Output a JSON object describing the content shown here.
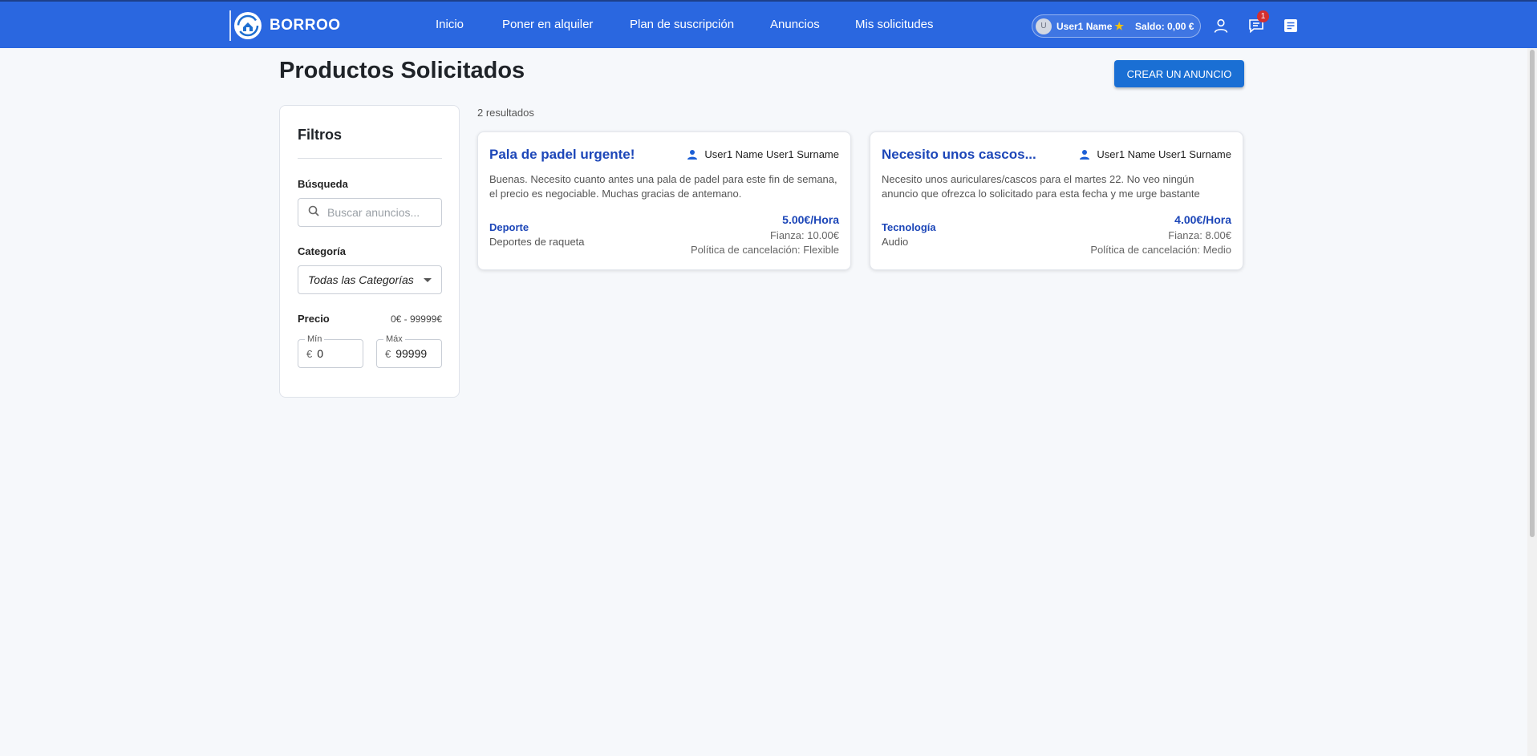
{
  "header": {
    "brand": "BORROO",
    "nav": [
      "Inicio",
      "Poner en alquiler",
      "Plan de suscripción",
      "Anuncios",
      "Mis solicitudes"
    ],
    "user": {
      "avatar_initial": "U",
      "name": "User1 Name",
      "balance": "Saldo: 0,00 €"
    },
    "messages_badge": "1",
    "icons": [
      "profile-icon",
      "chat-icon",
      "document-icon"
    ],
    "colors": {
      "bar": "#2a67e0",
      "badge": "#d32f2f",
      "star": "#f4c20d"
    }
  },
  "page": {
    "title": "Productos Solicitados",
    "create_button": "CREAR UN ANUNCIO"
  },
  "filters": {
    "title": "Filtros",
    "search_label": "Búsqueda",
    "search_placeholder": "Buscar anuncios...",
    "category_label": "Categoría",
    "category_selected": "Todas las Categorías",
    "price_label": "Precio",
    "price_range": "0€ - 99999€",
    "min_legend": "Mín",
    "max_legend": "Máx",
    "currency": "€",
    "min_value": "0",
    "max_value": "99999"
  },
  "results": {
    "count": "2 resultados",
    "cards": [
      {
        "title": "Pala de padel urgente!",
        "user": "User1 Name User1 Surname",
        "description": "Buenas. Necesito cuanto antes una pala de padel para este fin de semana, el precio es negociable. Muchas gracias de antemano.",
        "category": "Deporte",
        "subcategory": "Deportes de raqueta",
        "price": "5.00€/Hora",
        "deposit": "Fianza: 10.00€",
        "cancellation": "Política de cancelación: Flexible"
      },
      {
        "title": "Necesito unos cascos...",
        "user": "User1 Name User1 Surname",
        "description": "Necesito unos auriculares/cascos para el martes 22. No veo ningún anuncio que ofrezca lo solicitado para esta fecha y me urge bastante",
        "category": "Tecnología",
        "subcategory": "Audio",
        "price": "4.00€/Hora",
        "deposit": "Fianza: 8.00€",
        "cancellation": "Política de cancelación: Medio"
      }
    ]
  }
}
